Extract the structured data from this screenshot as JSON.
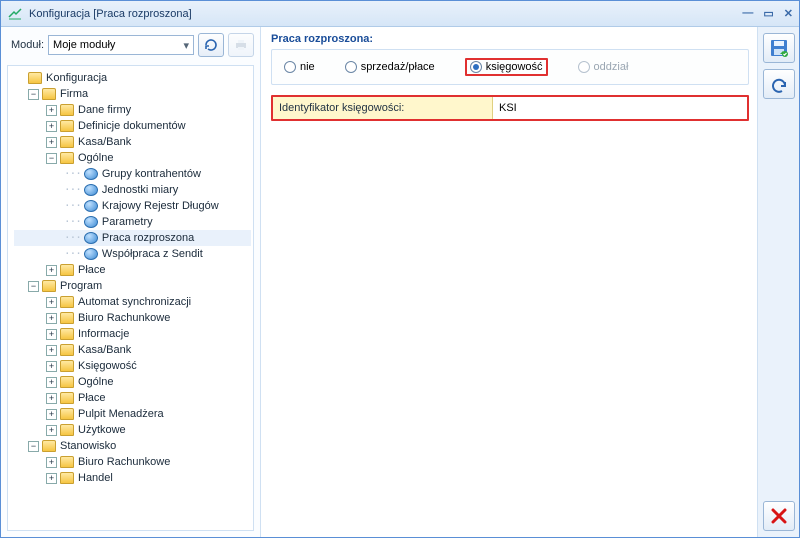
{
  "window": {
    "title": "Konfiguracja [Praca rozproszona]"
  },
  "module": {
    "label": "Moduł:",
    "selected": "Moje moduły"
  },
  "tree": {
    "root": "Konfiguracja",
    "firma": "Firma",
    "firma_items": [
      "Dane firmy",
      "Definicje dokumentów",
      "Kasa/Bank"
    ],
    "ogolne": "Ogólne",
    "ogolne_items": [
      "Grupy kontrahentów",
      "Jednostki miary",
      "Krajowy Rejestr Długów",
      "Parametry",
      "Praca rozproszona",
      "Współpraca z Sendit"
    ],
    "place": "Płace",
    "program": "Program",
    "program_items": [
      "Automat synchronizacji",
      "Biuro Rachunkowe",
      "Informacje",
      "Kasa/Bank",
      "Księgowość",
      "Ogólne",
      "Płace",
      "Pulpit Menadżera",
      "Użytkowe"
    ],
    "stanowisko": "Stanowisko",
    "stanowisko_items": [
      "Biuro Rachunkowe",
      "Handel"
    ]
  },
  "panel": {
    "group_title": "Praca rozproszona:",
    "opt_nie": "nie",
    "opt_sp": "sprzedaż/płace",
    "opt_ks": "księgowość",
    "opt_od": "oddział",
    "id_label": "Identyfikator księgowości:",
    "id_value": "KSI"
  }
}
